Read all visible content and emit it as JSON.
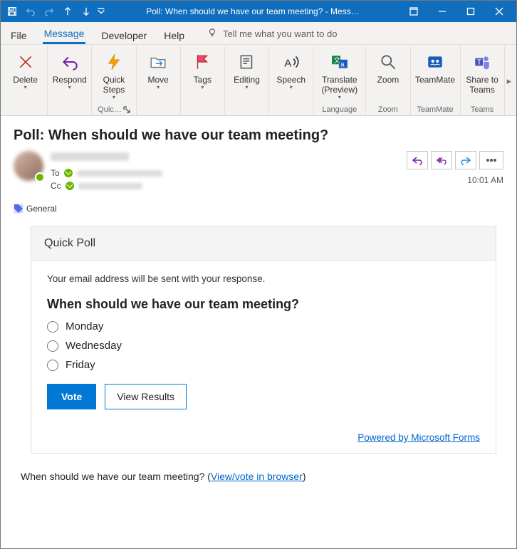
{
  "titlebar": {
    "title": "Poll: When should we have our team meeting?  -  Mess…"
  },
  "menu": {
    "file": "File",
    "message": "Message",
    "developer": "Developer",
    "help": "Help",
    "tell_me": "Tell me what you want to do"
  },
  "ribbon": {
    "delete": "Delete",
    "respond": "Respond",
    "quick_steps": "Quick\nSteps",
    "quick_steps_group": "Quic…",
    "move": "Move",
    "tags": "Tags",
    "editing": "Editing",
    "speech": "Speech",
    "translate": "Translate\n(Preview)",
    "language_group": "Language",
    "zoom": "Zoom",
    "zoom_group": "Zoom",
    "teammate": "TeamMate",
    "teammate_group": "TeamMate",
    "share_teams": "Share to\nTeams",
    "teams_group": "Teams"
  },
  "message_head": {
    "subject": "Poll: When should we have our team meeting?",
    "to_label": "To",
    "cc_label": "Cc",
    "time": "10:01 AM",
    "category": "General"
  },
  "poll": {
    "card_title": "Quick Poll",
    "note": "Your email address will be sent with your response.",
    "question": "When should we have our team meeting?",
    "options": [
      "Monday",
      "Wednesday",
      "Friday"
    ],
    "vote_btn": "Vote",
    "results_btn": "View Results",
    "powered": "Powered by Microsoft Forms"
  },
  "footer": {
    "text": "When should we have our team meeting? (",
    "link": "View/vote in browser",
    "close": ")"
  }
}
